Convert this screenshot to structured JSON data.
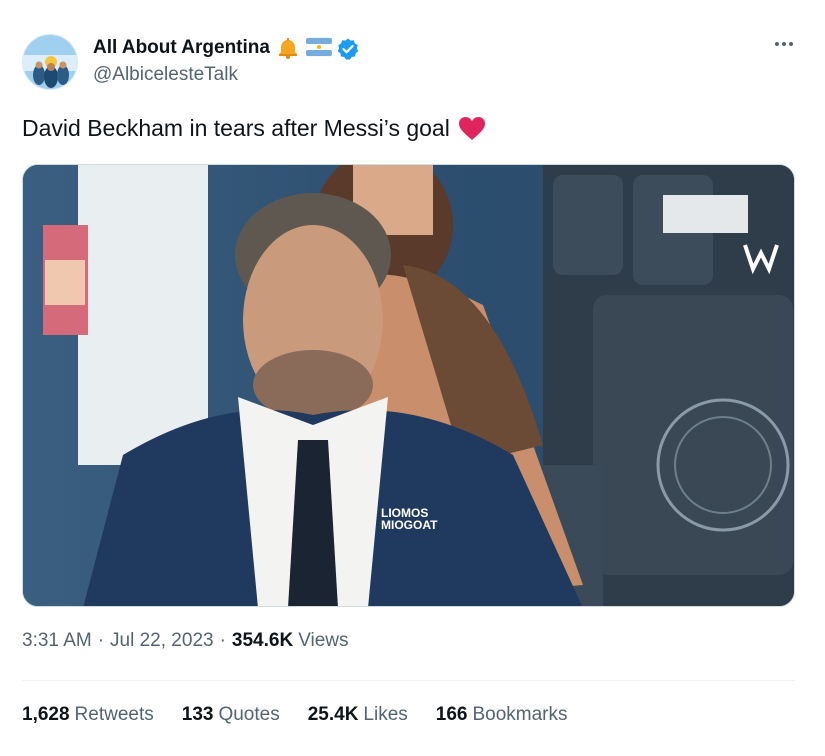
{
  "author": {
    "display_name": "All About Argentina",
    "handle": "@AlbicelesteTalk",
    "badges": [
      "bell-emoji-icon",
      "argentina-flag-icon",
      "verified-badge-icon"
    ],
    "verified_color": "#1d9bf0"
  },
  "tweet": {
    "text": "David Beckham in tears after Messi’s goal",
    "emoji": "red-heart-icon",
    "media_overlay_text_1": "LIOMOS",
    "media_overlay_text_2": "MIOGOAT"
  },
  "meta": {
    "time": "3:31 AM",
    "separator": "·",
    "date": "Jul 22, 2023",
    "views_count": "354.6K",
    "views_label": "Views"
  },
  "stats": {
    "retweets_count": "1,628",
    "retweets_label": "Retweets",
    "quotes_count": "133",
    "quotes_label": "Quotes",
    "likes_count": "25.4K",
    "likes_label": "Likes",
    "bookmarks_count": "166",
    "bookmarks_label": "Bookmarks"
  },
  "colors": {
    "text_primary": "#0f1419",
    "text_secondary": "#536471",
    "heart": "#e0245e",
    "divider": "#eff3f4"
  }
}
